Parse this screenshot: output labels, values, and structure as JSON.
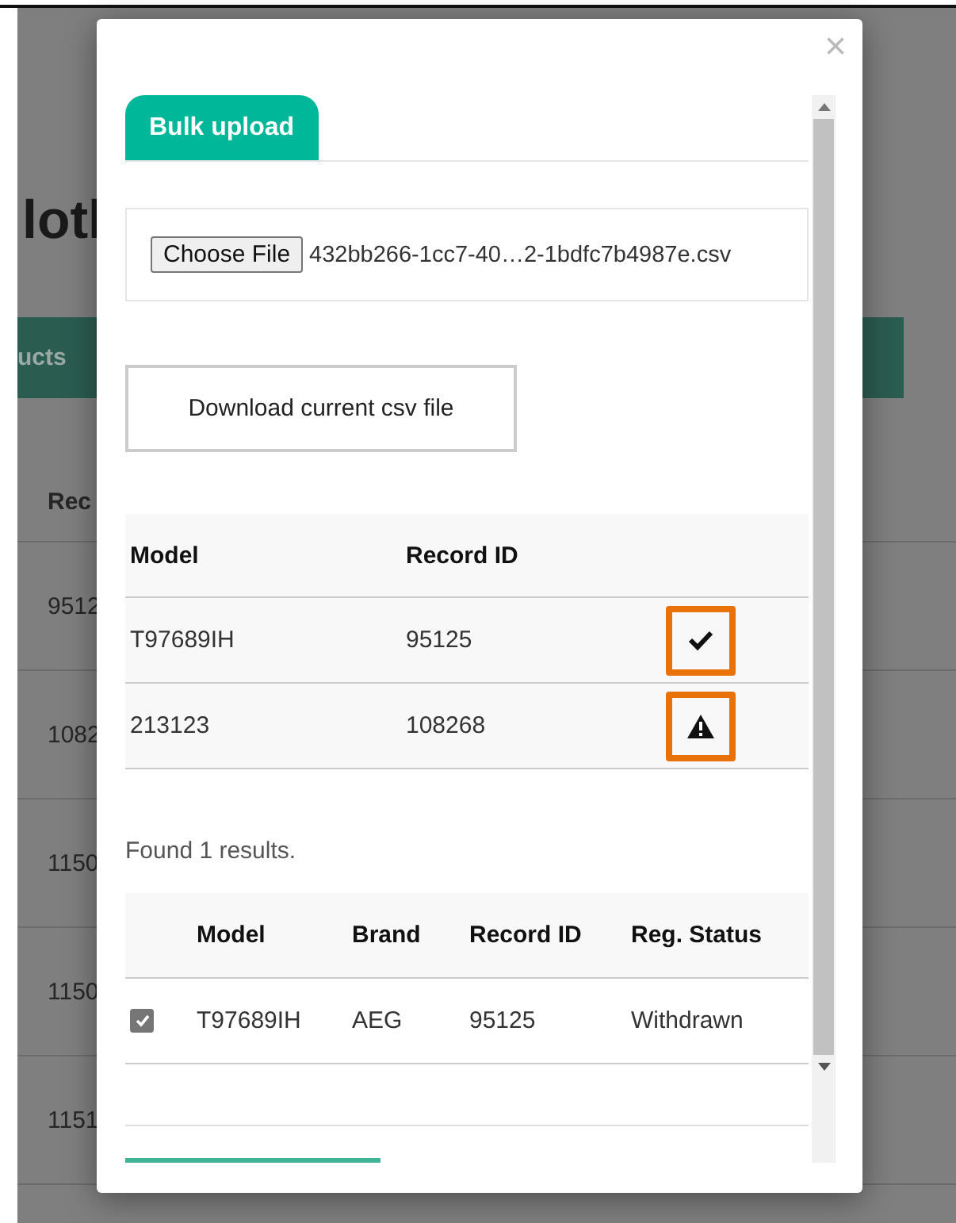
{
  "background_page": {
    "heading": "lotl",
    "nav_label": "ucts",
    "table_header": "Rec",
    "rows": [
      "9512",
      "1082",
      "1150",
      "1150",
      "1151"
    ]
  },
  "dialog": {
    "close": "×",
    "tabs": [
      {
        "label": "Bulk upload",
        "selected": true
      }
    ],
    "file_input": {
      "button": "Choose File",
      "file_name": "432bb266-1cc7-40…2-1bdfc7b4987e.csv"
    },
    "download_button": "Download current csv file",
    "upload_table": {
      "columns": [
        "Model",
        "Record ID"
      ],
      "rows": [
        {
          "model": "T97689IH",
          "record_id": "95125",
          "status": {
            "kind": "ok",
            "highlighted": true
          }
        },
        {
          "model": "213123",
          "record_id": "108268",
          "status": {
            "kind": "warning",
            "highlighted": true
          }
        }
      ]
    },
    "results_text": "Found 1 results.",
    "results_table": {
      "columns": [
        "Model",
        "Brand",
        "Record ID",
        "Reg. Status"
      ],
      "rows": [
        {
          "checked": true,
          "model": "T97689IH",
          "brand": "AEG",
          "record_id": "95125",
          "reg_status": "Withdrawn"
        }
      ]
    }
  }
}
